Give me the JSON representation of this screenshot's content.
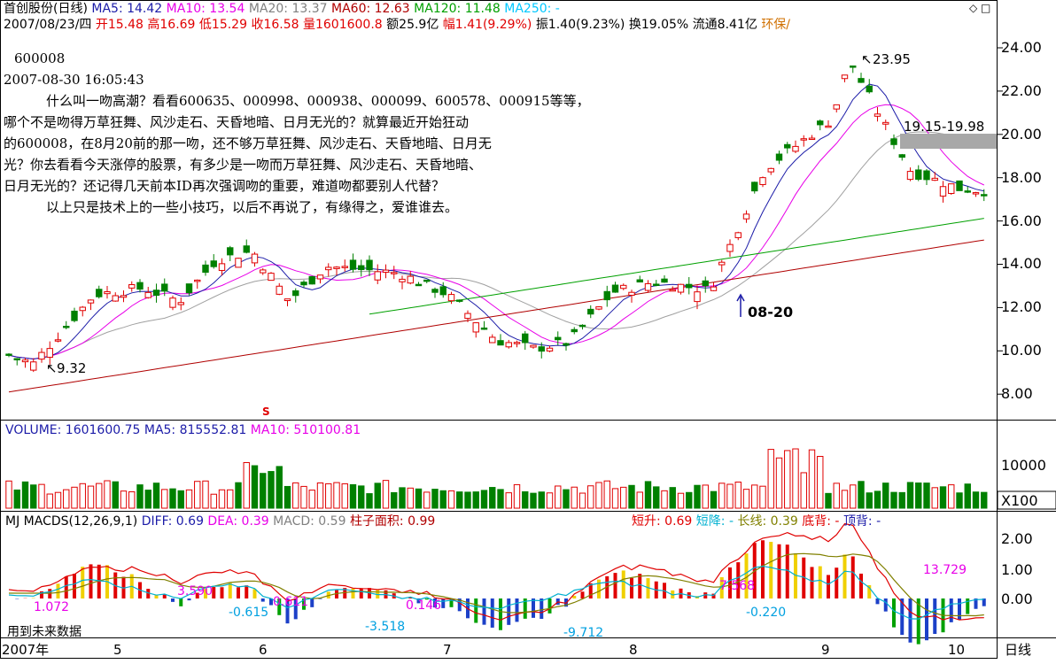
{
  "header": {
    "name": "首创股份(日线)",
    "ma": [
      {
        "label": "MA5: 14.42",
        "color": "#1c1ca8"
      },
      {
        "label": "MA10: 13.54",
        "color": "#e800e8"
      },
      {
        "label": "MA20: 13.37",
        "color": "#808080"
      },
      {
        "label": "MA60: 12.63",
        "color": "#b00000"
      },
      {
        "label": "MA120: 11.48",
        "color": "#00a000"
      },
      {
        "label": "MA250: -",
        "color": "#00c8ff"
      }
    ],
    "info": [
      {
        "t": "2007/08/23/四 ",
        "c": "#000"
      },
      {
        "t": "开15.48 ",
        "c": "#e00000"
      },
      {
        "t": "高16.69 ",
        "c": "#e00000"
      },
      {
        "t": "低15.29 ",
        "c": "#e00000"
      },
      {
        "t": "收16.58 ",
        "c": "#e00000"
      },
      {
        "t": "量1601600.8 ",
        "c": "#e00000"
      },
      {
        "t": "额25.9亿 ",
        "c": "#000"
      },
      {
        "t": "幅1.41(9.29%) ",
        "c": "#e00000"
      },
      {
        "t": "振1.40(9.23%) ",
        "c": "#000"
      },
      {
        "t": "换19.05% ",
        "c": "#000"
      },
      {
        "t": "流通8.41亿 ",
        "c": "#000"
      },
      {
        "t": "环保/",
        "c": "#d07000"
      }
    ],
    "corner_icons": "◇ □"
  },
  "note": {
    "lines": [
      "600008",
      "2007-08-30 16:05:43",
      "什么叫一吻高潮？看看600635、000998、000938、000099、600578、000915等等，",
      "哪个不是吻得万草狂舞、风沙走石、天昏地暗、日月无光的？就算最近开始狂动",
      "的600008，在8月20前的那一吻，还不够万草狂舞、风沙走石、天昏地暗、日月无",
      "光？你去看看今天涨停的股票，有多少是一吻而万草狂舞、风沙走石、天昏地暗、",
      "日月无光的？还记得几天前本ID再次强调吻的重要，难道吻都要别人代替？",
      "以上只是技术上的一些小技巧，以后不再说了，有缘得之，爱谁谁去。"
    ]
  },
  "price_axis": {
    "ticks": [
      "24.00",
      "22.00",
      "20.00",
      "18.00",
      "16.00",
      "14.00",
      "12.00",
      "10.00",
      "8.00"
    ]
  },
  "annotations": {
    "low": "9.32",
    "high": "23.95",
    "range": "19.15-19.98",
    "date_marker": "08-20",
    "s_marker": "S"
  },
  "volume": {
    "legend": [
      {
        "t": "VOLUME: 1601600.75 ",
        "c": "#1c1ca8"
      },
      {
        "t": "MA5: 815552.81 ",
        "c": "#1c1ca8"
      },
      {
        "t": "MA10: 510100.81",
        "c": "#e800e8"
      }
    ],
    "tick": "10000",
    "unit": "X100"
  },
  "macd": {
    "legend_left": [
      {
        "t": "MJ  ",
        "c": "#000"
      },
      {
        "t": "MACDS(12,26,9,1) ",
        "c": "#000"
      },
      {
        "t": "DIFF: 0.69 ",
        "c": "#1c1ca8"
      },
      {
        "t": "DEA: 0.39 ",
        "c": "#e800e8"
      },
      {
        "t": "MACD: 0.59 ",
        "c": "#808080"
      },
      {
        "t": "柱子面积: 0.99",
        "c": "#b00000"
      }
    ],
    "legend_right": [
      {
        "t": "短升: 0.69 ",
        "c": "#e00000"
      },
      {
        "t": "短降: - ",
        "c": "#00b0d0"
      },
      {
        "t": "长线: 0.39 ",
        "c": "#808000"
      },
      {
        "t": "底背: - ",
        "c": "#e00000"
      },
      {
        "t": "顶背: -",
        "c": "#1c1ca8"
      }
    ],
    "ticks": [
      "2.00",
      "1.00",
      "0.00"
    ],
    "area_labels": [
      "1.072",
      "3.590",
      "-0.615",
      "0.611",
      "-3.518",
      "0.146",
      "-9.712",
      "7.568",
      "-0.220",
      "13.729"
    ],
    "footer_note": "用到未来数据"
  },
  "time_axis": {
    "labels": [
      "2007年",
      "5",
      "6",
      "7",
      "8",
      "9",
      "10"
    ],
    "period": "日线"
  }
}
